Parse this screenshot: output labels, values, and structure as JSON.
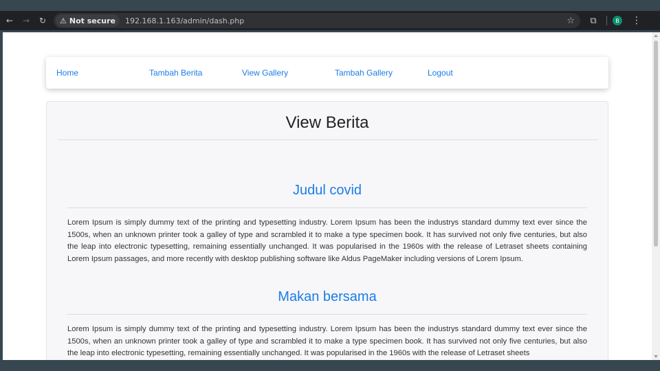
{
  "browser": {
    "security_label": "Not secure",
    "url": "192.168.1.163/admin/dash.php",
    "avatar_letter": "B",
    "accent_color": "#1a7ce8"
  },
  "nav": {
    "items": [
      {
        "label": "Home"
      },
      {
        "label": "Tambah Berita"
      },
      {
        "label": "View Gallery"
      },
      {
        "label": "Tambah Gallery"
      },
      {
        "label": "Logout"
      }
    ]
  },
  "page": {
    "title": "View Berita"
  },
  "posts": [
    {
      "title": "Judul covid",
      "body": "Lorem Ipsum is simply dummy text of the printing and typesetting industry. Lorem Ipsum has been the industrys standard dummy text ever since the 1500s, when an unknown printer took a galley of type and scrambled it to make a type specimen book. It has survived not only five centuries, but also the leap into electronic typesetting, remaining essentially unchanged. It was popularised in the 1960s with the release of Letraset sheets containing Lorem Ipsum passages, and more recently with desktop publishing software like Aldus PageMaker including versions of Lorem Ipsum."
    },
    {
      "title": "Makan bersama",
      "body": "Lorem Ipsum is simply dummy text of the printing and typesetting industry. Lorem Ipsum has been the industrys standard dummy text ever since the 1500s, when an unknown printer took a galley of type and scrambled it to make a type specimen book. It has survived not only five centuries, but also the leap into electronic typesetting, remaining essentially unchanged. It was popularised in the 1960s with the release of Letraset sheets"
    }
  ]
}
